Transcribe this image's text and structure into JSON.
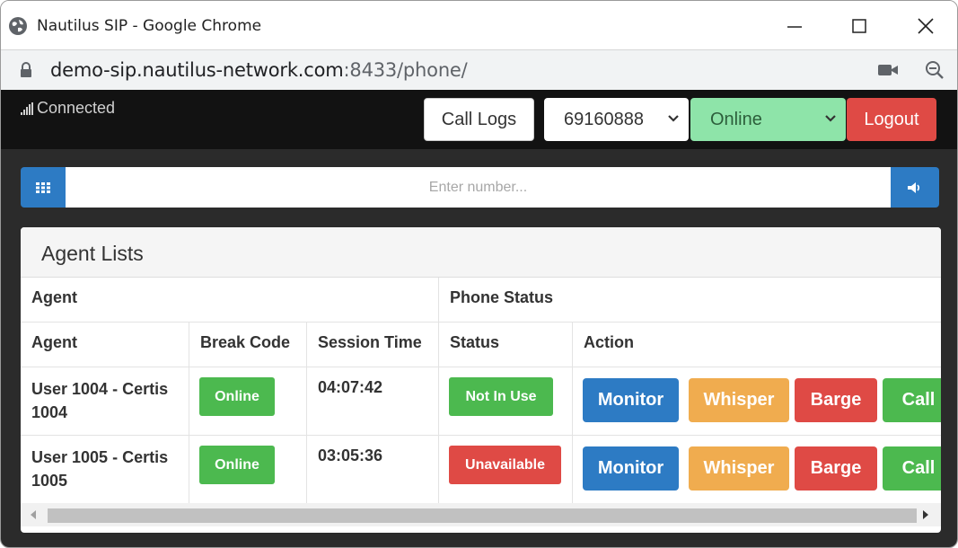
{
  "window": {
    "title": "Nautilus SIP - Google Chrome"
  },
  "address_bar": {
    "url_host": "demo-sip.nautilus-network.com",
    "url_rest": ":8433/phone/"
  },
  "navbar": {
    "connection_status": "Connected",
    "call_logs_label": "Call Logs",
    "extension_selected": "69160888",
    "presence_selected": "Online",
    "logout_label": "Logout"
  },
  "dial": {
    "placeholder": "Enter number..."
  },
  "agent_panel": {
    "title": "Agent Lists",
    "group_headers": [
      "Agent",
      "Phone Status"
    ],
    "columns": [
      "Agent",
      "Break Code",
      "Session Time",
      "Status",
      "Action"
    ],
    "rows": [
      {
        "agent_line1": "User 1004 - Certis",
        "agent_line2": "1004",
        "break_code": "Online",
        "session_time": "04:07:42",
        "status": "Not In Use",
        "actions": [
          "Monitor",
          "Whisper",
          "Barge",
          "Call"
        ]
      },
      {
        "agent_line1": "User 1005 - Certis",
        "agent_line2": "1005",
        "break_code": "Online",
        "session_time": "03:05:36",
        "status": "Unavailable",
        "actions": [
          "Monitor",
          "Whisper",
          "Barge",
          "Call"
        ]
      }
    ]
  },
  "colors": {
    "primary": "#2d7bc4",
    "success": "#4cb94f",
    "danger": "#df4a45",
    "warning": "#f0ac4f",
    "presence_online": "#8ee4a9"
  }
}
